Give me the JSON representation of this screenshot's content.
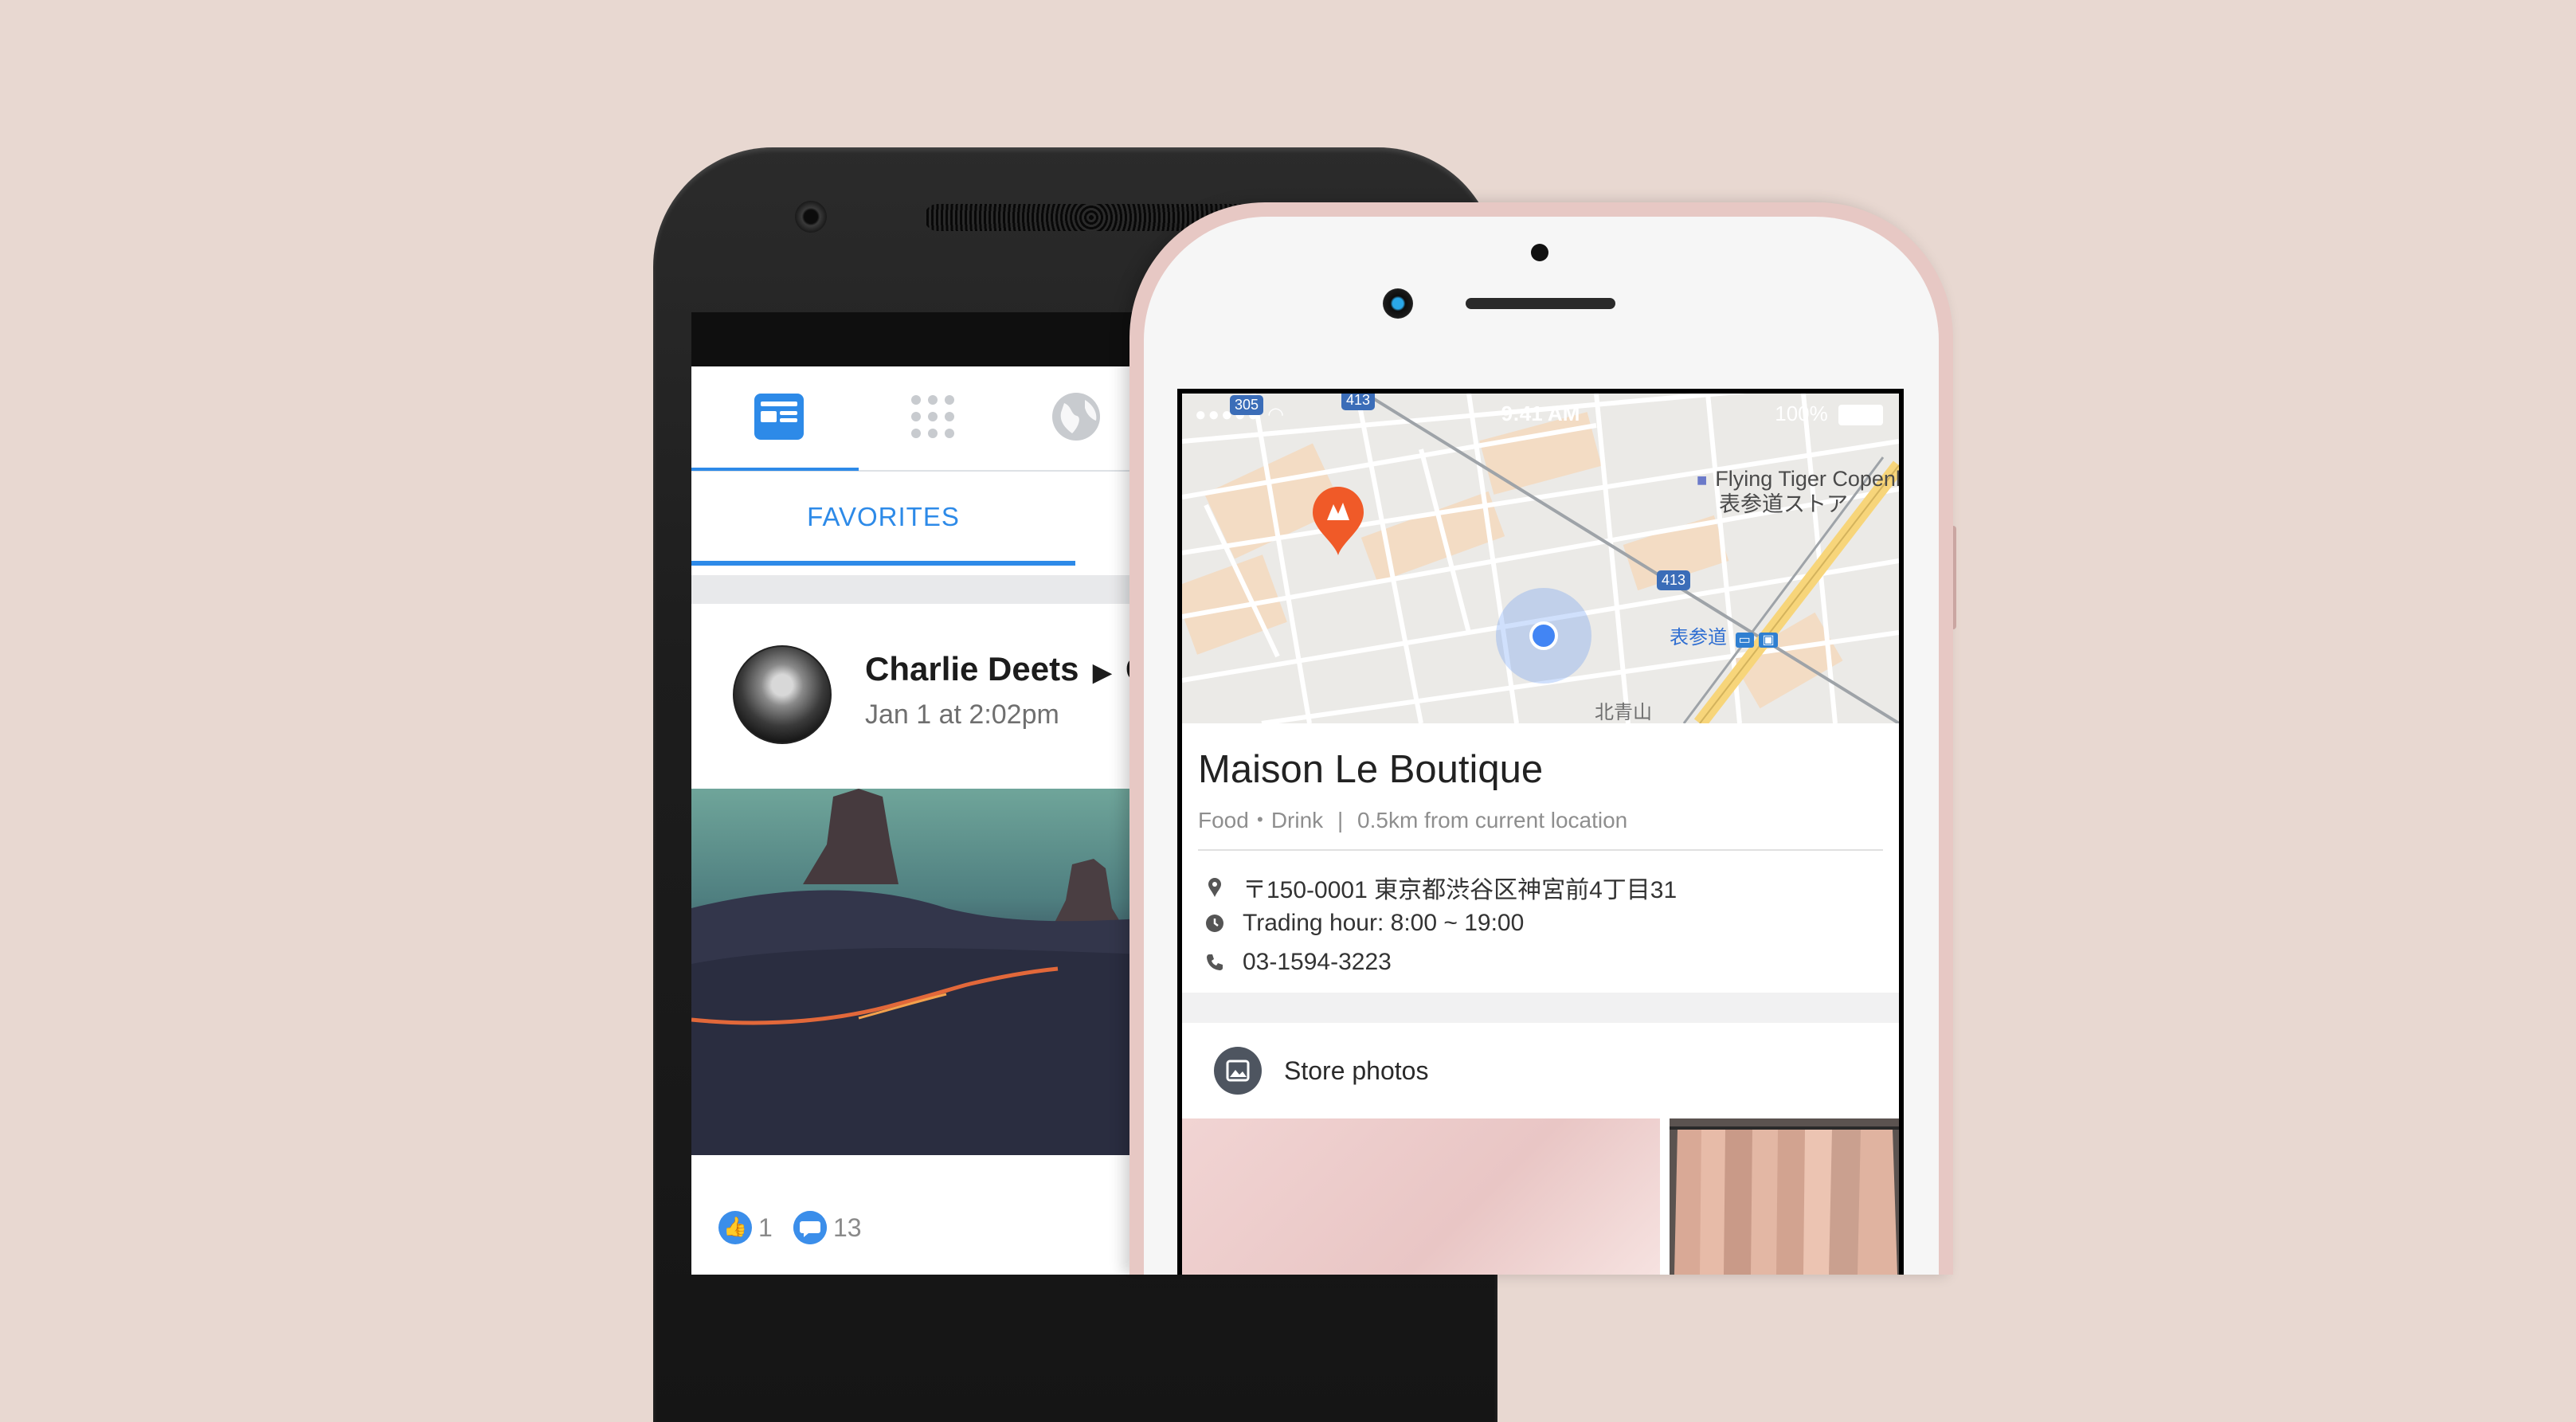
{
  "android": {
    "tabs": [
      {
        "icon": "news-feed-icon",
        "active": true
      },
      {
        "icon": "apps-grid-icon",
        "active": false
      },
      {
        "icon": "globe-icon",
        "active": false
      }
    ],
    "subtab": "FAVORITES",
    "post": {
      "author": "Charlie Deets",
      "target_partial": "G",
      "time": "Jan 1 at 2:02pm",
      "likes": "1",
      "comments": "13"
    },
    "accent": "#2d8ae8"
  },
  "iphone": {
    "status": {
      "time": "9:41 AM",
      "battery": "100%"
    },
    "map": {
      "poi_line1": "Flying Tiger Copenh",
      "poi_line2": "表参道ストア",
      "station": "表参道",
      "area": "北青山",
      "road_labels": [
        "305",
        "413",
        "413"
      ]
    },
    "place": {
      "name": "Maison Le Boutique",
      "category": "Food・Drink",
      "separator": "|",
      "distance": "0.5km from current location",
      "address": "〒150-0001 東京都渋谷区神宮前4丁目31",
      "hours": "Trading hour: 8:00 ~ 19:00",
      "phone": "03-1594-3223"
    },
    "photos": {
      "label": "Store photos"
    },
    "pin_color": "#f05a28",
    "location_color": "#4285f4"
  }
}
